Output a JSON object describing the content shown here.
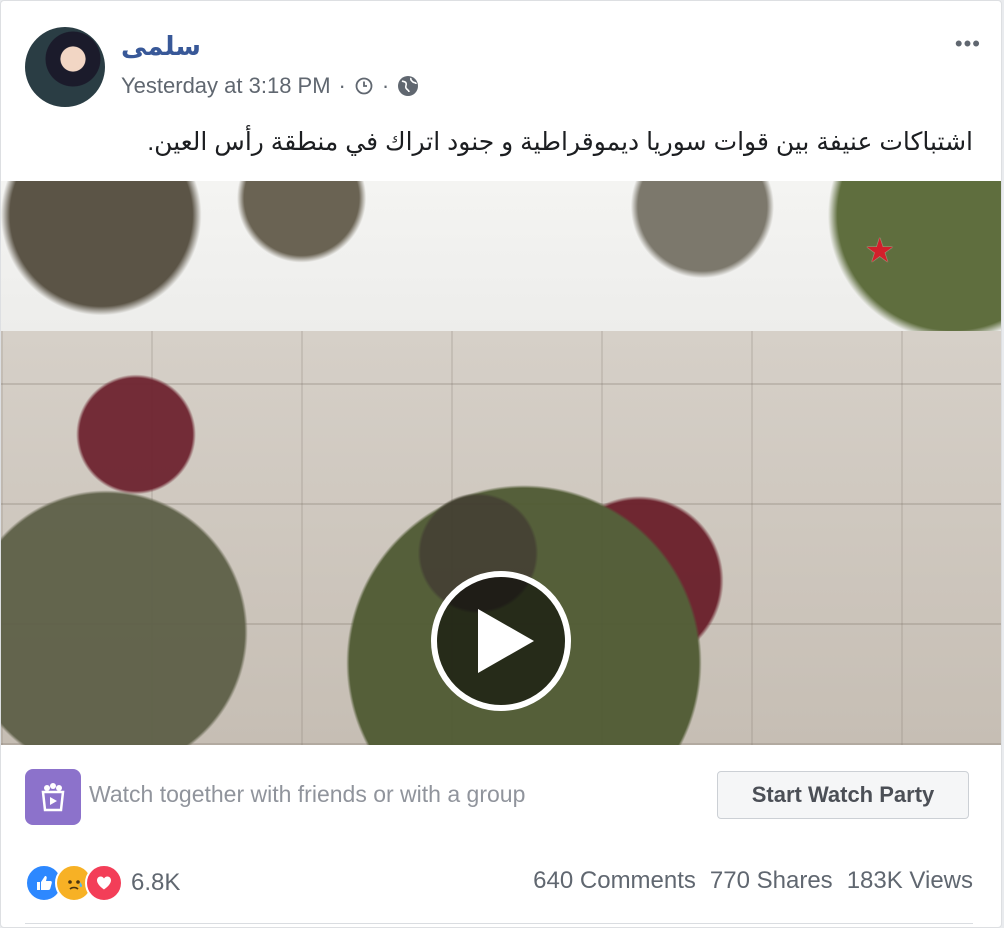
{
  "post": {
    "author": "سلمى",
    "timestamp": "Yesterday at 3:18 PM",
    "separator": "·",
    "text": "اشتباكات عنيفة بين قوات سوريا ديموقراطية و جنود اتراك في منطقة رأس العين.",
    "more_label": "•••"
  },
  "video": {
    "state": "paused",
    "play_icon": "play-icon",
    "watermark_icon": "red-star-icon"
  },
  "watch_party": {
    "prompt": "Watch together with friends or with a group",
    "button_label": "Start Watch Party",
    "icon": "watch-party-icon",
    "icon_color": "#8c72cb"
  },
  "engagement": {
    "reactions": [
      "like",
      "sad",
      "love"
    ],
    "reaction_count": "6.8K",
    "comments": "640 Comments",
    "shares": "770 Shares",
    "views": "183K Views"
  },
  "colors": {
    "author_link": "#385898",
    "like": "#2d88ff",
    "sad": "#f7b125",
    "love": "#f33e58"
  }
}
